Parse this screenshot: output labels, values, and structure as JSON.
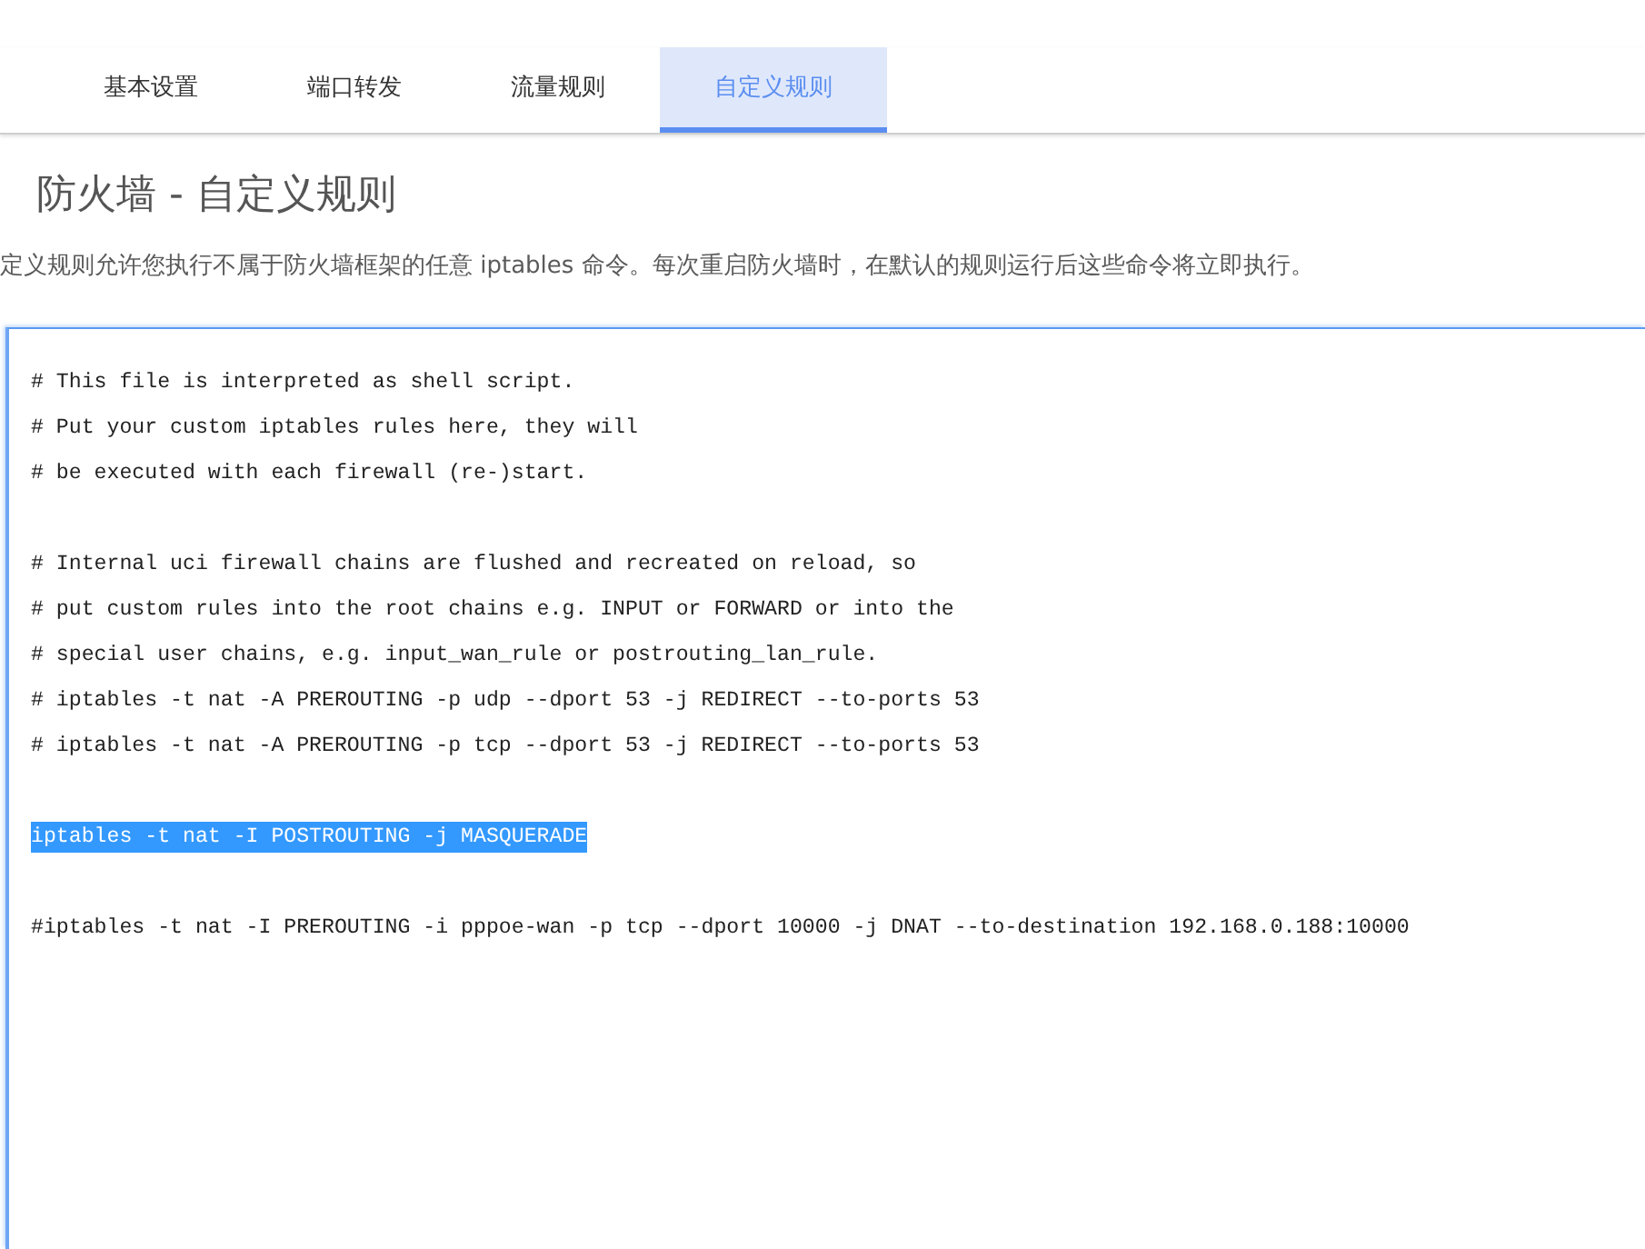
{
  "tabs": [
    {
      "label": "基本设置",
      "selected": false
    },
    {
      "label": "端口转发",
      "selected": false
    },
    {
      "label": "流量规则",
      "selected": false
    },
    {
      "label": "自定义规则",
      "selected": true
    }
  ],
  "page": {
    "title": "防火墙 - 自定义规则",
    "description": "定义规则允许您执行不属于防火墙框架的任意 iptables 命令。每次重启防火墙时，在默认的规则运行后这些命令将立即执行。"
  },
  "editor": {
    "blocks": [
      [
        {
          "text": "# This file is interpreted as shell script.",
          "selected": false
        },
        {
          "text": "# Put your custom iptables rules here, they will",
          "selected": false
        },
        {
          "text": "# be executed with each firewall (re-)start.",
          "selected": false
        }
      ],
      [
        {
          "text": "# Internal uci firewall chains are flushed and recreated on reload, so",
          "selected": false
        },
        {
          "text": "# put custom rules into the root chains e.g. INPUT or FORWARD or into the",
          "selected": false
        },
        {
          "text": "# special user chains, e.g. input_wan_rule or postrouting_lan_rule.",
          "selected": false
        },
        {
          "text": "# iptables -t nat -A PREROUTING -p udp --dport 53 -j REDIRECT --to-ports 53",
          "selected": false
        },
        {
          "text": "# iptables -t nat -A PREROUTING -p tcp --dport 53 -j REDIRECT --to-ports 53",
          "selected": false
        }
      ],
      [
        {
          "text": "iptables -t nat -I POSTROUTING -j MASQUERADE",
          "selected": true
        }
      ],
      [
        {
          "text": "#iptables -t nat -I PREROUTING -i pppoe-wan -p tcp --dport 10000 -j DNAT --to-destination 192.168.0.188:10000",
          "selected": false
        }
      ]
    ]
  }
}
